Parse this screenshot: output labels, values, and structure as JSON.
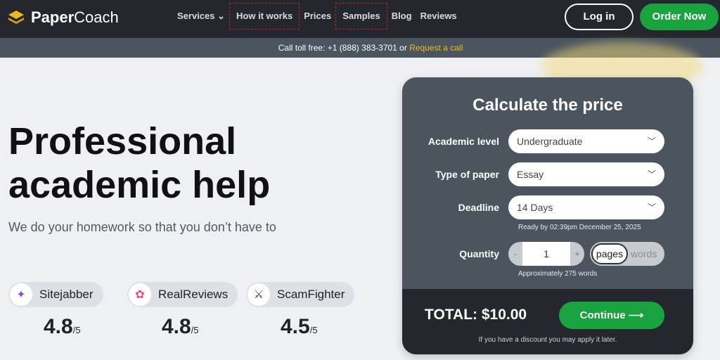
{
  "brand": {
    "bold": "Paper",
    "light": "Coach"
  },
  "nav": {
    "items": [
      "Services",
      "How it works",
      "Prices",
      "Samples",
      "Blog",
      "Reviews"
    ],
    "login": "Log in",
    "order": "Order Now"
  },
  "subbar": {
    "text": "Call toll free: +1 (888) 383-3701  or ",
    "link": "Request a call"
  },
  "hero": {
    "title_line1": "Professional",
    "title_line2": "academic help",
    "tagline": "We do your homework so that you don’t have to"
  },
  "reviews": [
    {
      "name": "Sitejabber",
      "score": "4.8",
      "max": "/5",
      "icon": "sitejabber-icon"
    },
    {
      "name": "RealReviews",
      "score": "4.8",
      "max": "/5",
      "icon": "realreviews-icon"
    },
    {
      "name": "ScamFighter",
      "score": "4.5",
      "max": "/5",
      "icon": "scamfighter-icon"
    }
  ],
  "calculator": {
    "title": "Calculate the price",
    "academic_level": {
      "label": "Academic level",
      "value": "Undergraduate"
    },
    "type_of_paper": {
      "label": "Type of paper",
      "value": "Essay"
    },
    "deadline": {
      "label": "Deadline",
      "value": "14 Days",
      "hint": "Ready by 02:39pm December 25, 2025"
    },
    "quantity": {
      "label": "Quantity",
      "minus": "-",
      "value": "1",
      "plus": "+",
      "unit_pages": "pages",
      "unit_words": "words",
      "hint": "Approximately 275 words"
    },
    "total": "TOTAL: $10.00",
    "continue": "Continue",
    "discount": "If you have a discount you may apply it later."
  },
  "colors": {
    "accent_green": "#19a33f",
    "link_yellow": "#f1b91e",
    "nav_bg": "#24282e"
  }
}
